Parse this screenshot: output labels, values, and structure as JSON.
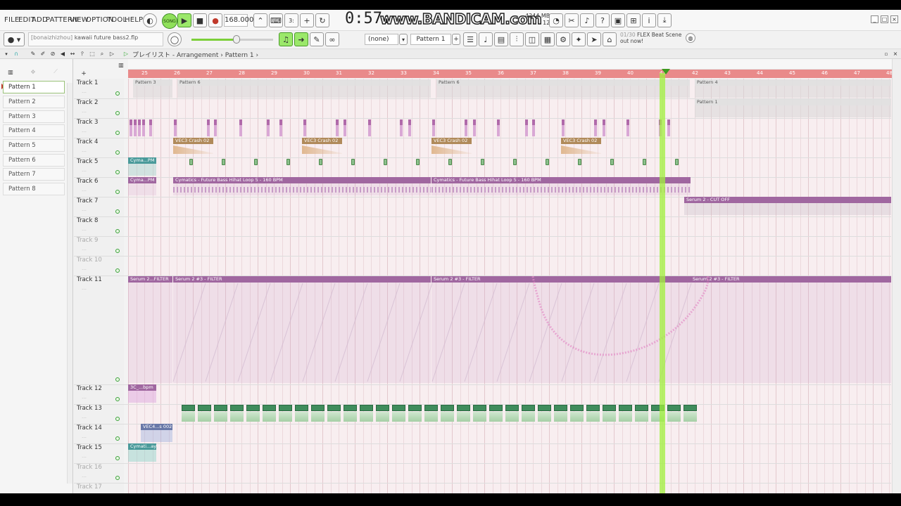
{
  "menu": [
    "FILE",
    "EDIT",
    "ADD",
    "PATTERN",
    "VIEW",
    "OPTION",
    "TOOL",
    "HELP"
  ],
  "transport": {
    "song_label": "SONG",
    "bpm": "168.000",
    "time": "0:57:",
    "memory": "4244 MB",
    "cpu": "12"
  },
  "watermark": "www.BANDICAM.com",
  "file_hint": {
    "user": "[bonaizhizhou]",
    "filename": "kawaii future bass2.flp"
  },
  "snap": "(none)",
  "pattern_selector": "Pattern 1",
  "news": {
    "counter": "01/30",
    "title": "FLEX Beat Scene",
    "line2": "out now!"
  },
  "playlist_title": "プレイリスト - Arrangement › Pattern 1 ›",
  "patterns": [
    "Pattern 1",
    "Pattern 2",
    "Pattern 3",
    "Pattern 4",
    "Pattern 5",
    "Pattern 6",
    "Pattern 7",
    "Pattern 8"
  ],
  "timeline_ticks": [
    "25",
    "26",
    "27",
    "28",
    "29",
    "30",
    "31",
    "32",
    "33",
    "34",
    "35",
    "36",
    "37",
    "38",
    "39",
    "40",
    "41",
    "42",
    "43",
    "44",
    "45",
    "46",
    "47",
    "48"
  ],
  "tracks": [
    {
      "label": "Track 1"
    },
    {
      "label": "Track 2"
    },
    {
      "label": "Track 3"
    },
    {
      "label": "Track 4"
    },
    {
      "label": "Track 5"
    },
    {
      "label": "Track 6"
    },
    {
      "label": "Track 7"
    },
    {
      "label": "Track 8"
    },
    {
      "label": "Track 9"
    },
    {
      "label": "Track 10"
    },
    {
      "label": "Track 11"
    },
    {
      "label": "Track 12"
    },
    {
      "label": "Track 13"
    },
    {
      "label": "Track 14"
    },
    {
      "label": "Track 15"
    },
    {
      "label": "Track 16"
    },
    {
      "label": "Track 17"
    }
  ],
  "clips": {
    "t1_a": "Pattern 3",
    "t1_b": "Pattern 6",
    "t1_c": "Pattern 6",
    "t1_d": "Pattern 4",
    "t2_a": "Pattern 1",
    "t4_crash": "VEC3 Crash 02",
    "t5_a": "Cyma...PM",
    "t6_a": "Cyma...PM",
    "t6_b": "Cymatics - Future Bass Hihat Loop 5 - 160 BPM",
    "t6_c": "Cymatics - Future Bass Hihat Loop 5 - 160 BPM",
    "t7_a": "Serum 2 - CUT OFF",
    "t11_a": "Serum 2...FILTER",
    "t11_b": "Serum 2 #3 - FILTER",
    "t11_c": "Serum 2 #3 - FILTER",
    "t11_d": "Serum 2 #3 - FILTER",
    "t12_a": "3C_...bpm",
    "t14_a": "VEC4...s 002",
    "t15_a": "Cymati...ay"
  },
  "colors": {
    "timeline": "#e98a8a",
    "playhead": "#a0f03c",
    "automation": "#a067a0",
    "grid_bg": "#f8eef0"
  }
}
